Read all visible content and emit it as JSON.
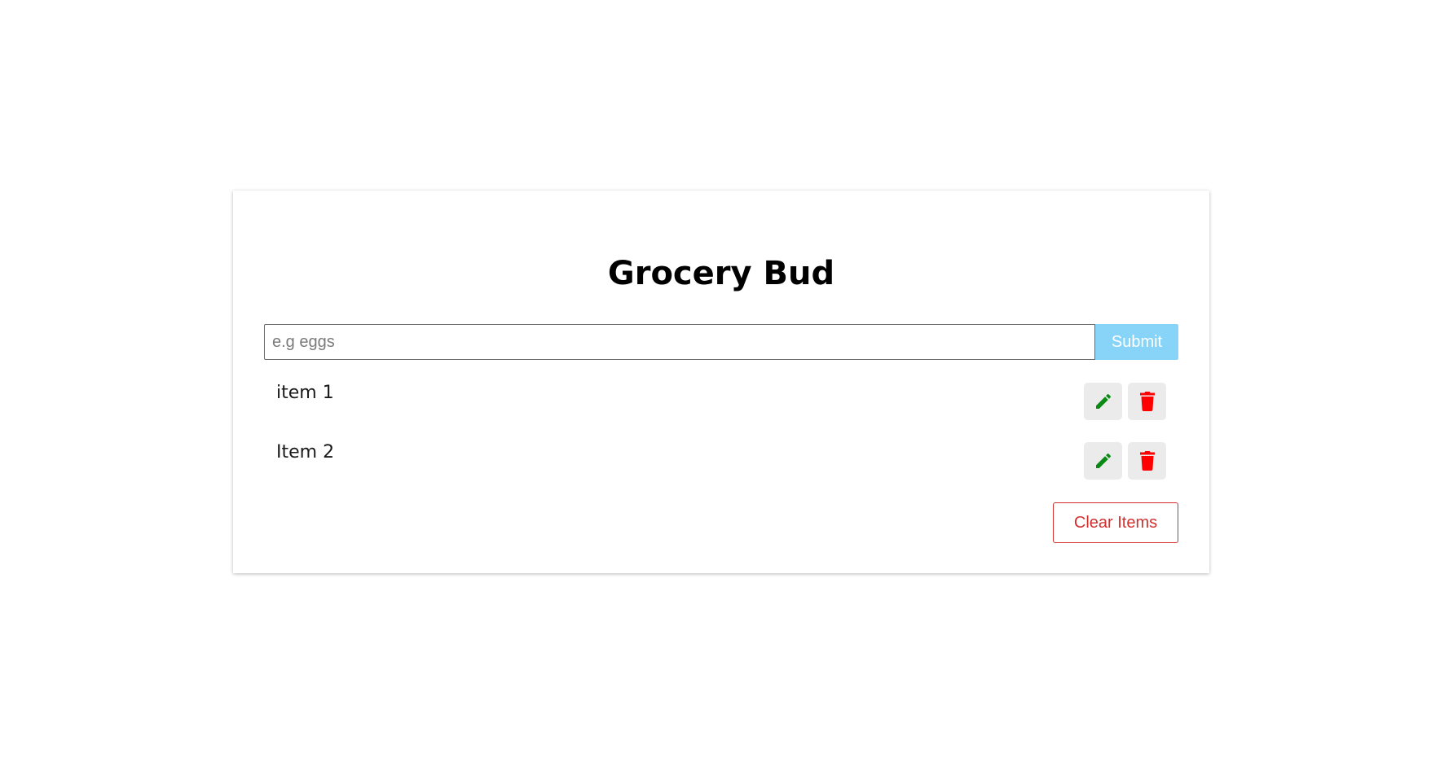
{
  "app": {
    "title": "Grocery Bud"
  },
  "form": {
    "input_value": "",
    "placeholder": "e.g eggs",
    "submit_label": "Submit"
  },
  "items": [
    {
      "label": "item 1"
    },
    {
      "label": "Item 2"
    }
  ],
  "icons": {
    "edit": "pencil-icon",
    "delete": "trash-icon"
  },
  "colors": {
    "submit_bg": "#87d4f8",
    "edit_icon": "#0a8a14",
    "delete_icon": "#ff0000",
    "clear_accent": "#d32f2f"
  },
  "footer": {
    "clear_label": "Clear Items"
  }
}
